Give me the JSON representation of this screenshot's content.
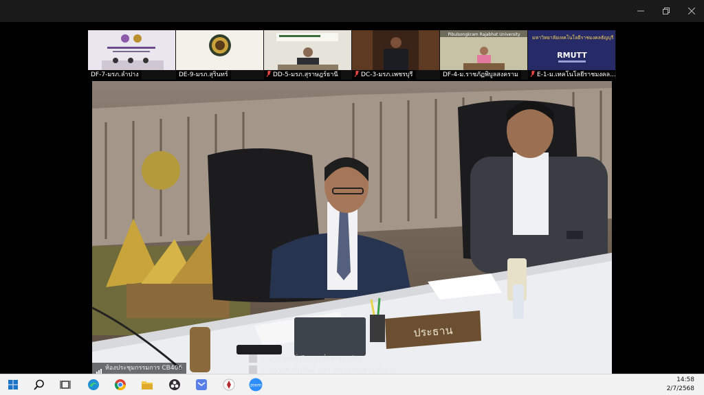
{
  "window": {
    "controls": [
      "minimize-icon",
      "restore-icon",
      "close-icon"
    ]
  },
  "thumbnails": [
    {
      "label": "DF-7-มรภ.ลำปาง",
      "muted": false
    },
    {
      "label": "DE-9-มรภ.สุรินทร์",
      "muted": false
    },
    {
      "label": "DD-5-มรภ.สุราษฎร์ธานี",
      "muted": true
    },
    {
      "label": "DC-3-มรภ.เพชรบุรี",
      "muted": true
    },
    {
      "label": "DF-4-ม.ราชภัฏพิบูลสงคราม",
      "muted": false,
      "banner": "Pibulsongkram Rajabhat University"
    },
    {
      "label": "E-1-ม.เทคโนโลยีราชมงคล...",
      "muted": true,
      "banner": "มหาวิทยาลัยเทคโนโลยีราชมงคลธัญบุรี",
      "logo": "RMUTT"
    }
  ],
  "main_video": {
    "room_label": "ห้องประชุมกรรมการ CB406",
    "nameplate": "ประธาน",
    "overlay_lines": [
      {
        "icon": "camera-icon",
        "text": "งานบริหารทั่วไปและสื่อสารองค์กร"
      },
      {
        "icon": "facebook-icon",
        "text": "งานประชาสัมพันธ์ มหาวิทยาลัยราชภัฏลำปาง"
      }
    ]
  },
  "taskbar": {
    "apps": [
      "windows-start-icon",
      "search-icon",
      "task-view-icon",
      "edge-icon",
      "chrome-icon",
      "file-explorer-icon",
      "obs-icon",
      "mail-icon",
      "emblem-app-icon",
      "zoom-icon"
    ],
    "zoom_label": "zoom",
    "time": "14:58",
    "date": "2/7/2568"
  },
  "colors": {
    "titlebar": "#1a1a1a",
    "taskbar": "#f2f2f2",
    "zoom_blue": "#2d8cff"
  }
}
